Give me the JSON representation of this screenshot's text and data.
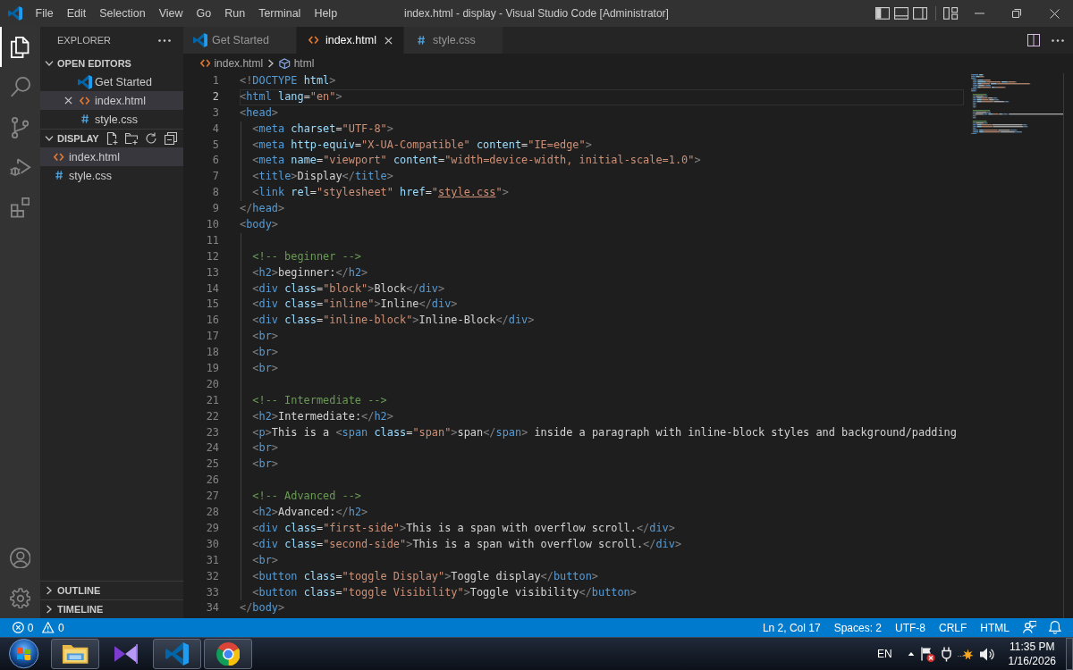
{
  "title_bar": {
    "menu": [
      "File",
      "Edit",
      "Selection",
      "View",
      "Go",
      "Run",
      "Terminal",
      "Help"
    ],
    "title": "index.html - display - Visual Studio Code [Administrator]"
  },
  "activity_bar": [
    {
      "selected": true
    },
    {
      "selected": false
    },
    {
      "selected": false
    },
    {
      "selected": false
    },
    {
      "selected": false
    }
  ],
  "sidebar": {
    "title": "EXPLORER",
    "sections": [
      {
        "title": "OPEN EDITORS",
        "kind": "editors",
        "expanded": true,
        "actions": false,
        "items": [
          {
            "label": "Get Started",
            "kind": "welcome",
            "selected": false,
            "close": false
          },
          {
            "label": "index.html",
            "kind": "html",
            "selected": true,
            "close": true
          },
          {
            "label": "style.css",
            "kind": "css",
            "selected": false,
            "close": false
          }
        ]
      },
      {
        "title": "DISPLAY",
        "kind": "folder",
        "expanded": true,
        "actions": true,
        "items": [
          {
            "label": "index.html",
            "kind": "html",
            "selected": true
          },
          {
            "label": "style.css",
            "kind": "css",
            "selected": false
          }
        ]
      }
    ],
    "panels": [
      {
        "title": "OUTLINE",
        "expanded": false
      },
      {
        "title": "TIMELINE",
        "expanded": false
      }
    ]
  },
  "tabs": [
    {
      "label": "Get Started",
      "kind": "welcome",
      "selected": false
    },
    {
      "label": "index.html",
      "kind": "html",
      "selected": true
    },
    {
      "label": "style.css",
      "kind": "css",
      "selected": false
    }
  ],
  "breadcrumbs": [
    {
      "label": "index.html",
      "kind": "html"
    },
    {
      "label": "html",
      "kind": "element"
    }
  ],
  "editor": {
    "lines": [
      {
        "number": "1",
        "text": "<!DOCTYPE html>",
        "current": false
      },
      {
        "number": "2",
        "text": "<html lang=\"en\">",
        "current": true
      },
      {
        "number": "3",
        "text": "<head>",
        "current": false
      },
      {
        "number": "4",
        "text": "  <meta charset=\"UTF-8\">",
        "current": false
      },
      {
        "number": "5",
        "text": "  <meta http-equiv=\"X-UA-Compatible\" content=\"IE=edge\">",
        "current": false
      },
      {
        "number": "6",
        "text": "  <meta name=\"viewport\" content=\"width=device-width, initial-scale=1.0\">",
        "current": false
      },
      {
        "number": "7",
        "text": "  <title>Display</title>",
        "current": false
      },
      {
        "number": "8",
        "text": "  <link rel=\"stylesheet\" href=\"",
        "link": "style.css",
        "after": "\">",
        "current": false
      },
      {
        "number": "9",
        "text": "</head>",
        "current": false
      },
      {
        "number": "10",
        "text": "<body>",
        "current": false
      },
      {
        "number": "11",
        "current": false
      },
      {
        "number": "12",
        "text": "  <!-- beginner -->",
        "current": false
      },
      {
        "number": "13",
        "text": "  <h2>beginner:</h2>",
        "current": false
      },
      {
        "number": "14",
        "text": "  <div class=\"block\">Block</div>",
        "current": false
      },
      {
        "number": "15",
        "text": "  <div class=\"inline\">Inline</div>",
        "current": false
      },
      {
        "number": "16",
        "text": "  <div class=\"inline-block\">Inline-Block</div>",
        "current": false
      },
      {
        "number": "17",
        "text": "  <br>",
        "current": false
      },
      {
        "number": "18",
        "text": "  <br>",
        "current": false
      },
      {
        "number": "19",
        "text": "  <br>",
        "current": false
      },
      {
        "number": "20",
        "current": false
      },
      {
        "number": "21",
        "text": "  <!-- Intermediate -->",
        "current": false
      },
      {
        "number": "22",
        "text": "  <h2>Intermediate:</h2>",
        "current": false
      },
      {
        "number": "23",
        "text": "  <p>This is a <span class=\"span\">span</span> inside a paragraph with inline-block styles and background/padding",
        "current": false
      },
      {
        "number": "24",
        "text": "  <br>",
        "current": false
      },
      {
        "number": "25",
        "text": "  <br>",
        "current": false
      },
      {
        "number": "26",
        "current": false
      },
      {
        "number": "27",
        "text": "  <!-- Advanced -->",
        "current": false
      },
      {
        "number": "28",
        "text": "  <h2>Advanced:</h2>",
        "current": false
      },
      {
        "number": "29",
        "text": "  <div class=\"first-side\">This is a span with overflow scroll.</div>",
        "current": false
      },
      {
        "number": "30",
        "text": "  <div class=\"second-side\">This is a span with overflow scroll.</div>",
        "current": false
      },
      {
        "number": "31",
        "text": "  <br>",
        "current": false
      },
      {
        "number": "32",
        "text": "  <button class=\"toggle Display\">Toggle display</button>",
        "current": false
      },
      {
        "number": "33",
        "text": "  <button class=\"toggle Visibility\">Toggle visibility</button>",
        "current": false
      },
      {
        "number": "34",
        "text": "</body>",
        "current": false
      }
    ]
  },
  "status_bar": {
    "errors": "0",
    "warnings": "0",
    "items": [
      "Ln 2, Col 17",
      "Spaces: 2",
      "UTF-8",
      "CRLF",
      "HTML"
    ]
  },
  "taskbar": {
    "apps": [
      {
        "running": true
      },
      {
        "running": false
      },
      {
        "running": true
      },
      {
        "running": true
      }
    ],
    "language": "EN",
    "time": "11:35 PM",
    "date": "1/16/2026"
  }
}
